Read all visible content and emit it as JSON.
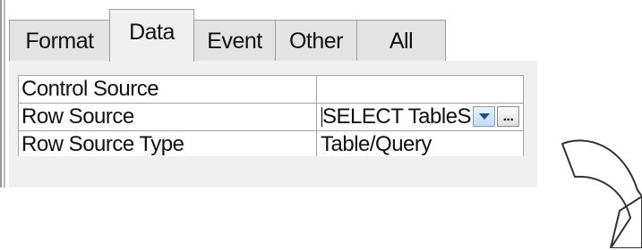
{
  "tabs": [
    {
      "label": "Format"
    },
    {
      "label": "Data"
    },
    {
      "label": "Event"
    },
    {
      "label": "Other"
    },
    {
      "label": "All"
    }
  ],
  "active_tab": "Data",
  "properties": [
    {
      "label": "Control Source",
      "value": ""
    },
    {
      "label": "Row Source",
      "value": "SELECT TableS"
    },
    {
      "label": "Row Source Type",
      "value": "Table/Query"
    }
  ],
  "builder_button_label": "...",
  "icons": {
    "dropdown": "chevron-down-icon",
    "builder": "ellipsis-icon",
    "annotation": "curved-arrow-icon"
  },
  "colors": {
    "panel": "#f0f0f0",
    "tab_inactive": "#e3e3e3",
    "grid_border": "#a3a3a3",
    "dropdown_arrow": "#1a4d99"
  }
}
